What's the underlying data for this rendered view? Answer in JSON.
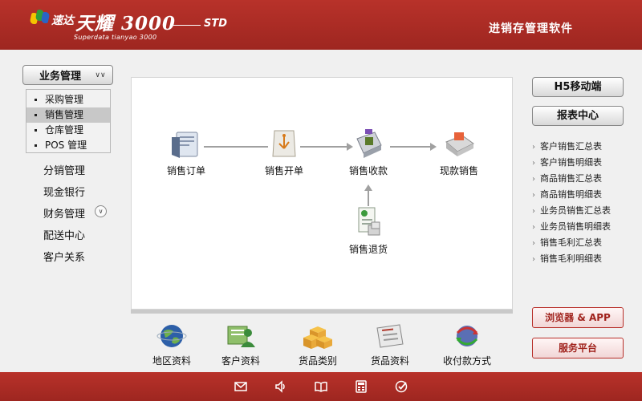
{
  "header": {
    "logo_small": "速达",
    "logo_big": "天耀 3000",
    "logo_edition": "STD",
    "logo_subtitle": "Superdata tianyao 3000",
    "product_title": "进销存管理软件"
  },
  "sidebar": {
    "business_label": "业务管理",
    "sub_items": [
      {
        "label": "采购管理"
      },
      {
        "label": "销售管理"
      },
      {
        "label": "仓库管理"
      },
      {
        "label": "POS 管理"
      }
    ],
    "items": [
      {
        "label": "分销管理"
      },
      {
        "label": "现金银行"
      },
      {
        "label": "财务管理"
      },
      {
        "label": "配送中心"
      },
      {
        "label": "客户关系"
      }
    ]
  },
  "flow": {
    "sales_order": "销售订单",
    "sales_invoice": "销售开单",
    "sales_receipt": "销售收款",
    "cash_sale": "现款销售",
    "sales_return": "销售退货"
  },
  "shortcuts": [
    {
      "label": "地区资料",
      "icon": "globe-icon"
    },
    {
      "label": "客户资料",
      "icon": "customer-card-icon"
    },
    {
      "label": "货品类别",
      "icon": "boxes-icon"
    },
    {
      "label": "货品资料",
      "icon": "product-card-icon"
    },
    {
      "label": "收付款方式",
      "icon": "payment-icon"
    }
  ],
  "right_panel": {
    "h5_label": "H5移动端",
    "report_label": "报表中心",
    "report_links": [
      {
        "label": "客户销售汇总表"
      },
      {
        "label": "客户销售明细表"
      },
      {
        "label": "商品销售汇总表"
      },
      {
        "label": "商品销售明细表"
      },
      {
        "label": "业务员销售汇总表"
      },
      {
        "label": "业务员销售明细表"
      },
      {
        "label": "销售毛利汇总表"
      },
      {
        "label": "销售毛利明细表"
      }
    ],
    "browser_app_label": "浏览器 & APP",
    "service_label": "服务平台"
  },
  "footer_icons": [
    "mail-icon",
    "speaker-icon",
    "book-icon",
    "calculator-icon",
    "check-icon"
  ],
  "colors": {
    "brand_red": "#a8281f",
    "panel_bg": "#f0f0f0"
  }
}
